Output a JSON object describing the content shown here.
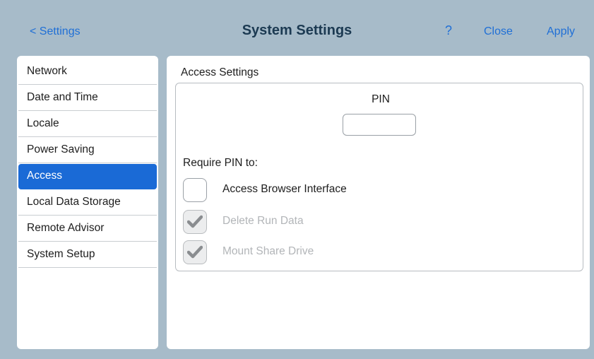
{
  "header": {
    "back_label": "< Settings",
    "title": "System Settings",
    "help_label": "?",
    "close_label": "Close",
    "apply_label": "Apply"
  },
  "sidebar": {
    "items": [
      {
        "label": "Network",
        "active": false
      },
      {
        "label": "Date and Time",
        "active": false
      },
      {
        "label": "Locale",
        "active": false
      },
      {
        "label": "Power Saving",
        "active": false
      },
      {
        "label": "Access",
        "active": true
      },
      {
        "label": "Local Data Storage",
        "active": false
      },
      {
        "label": "Remote Advisor",
        "active": false
      },
      {
        "label": "System Setup",
        "active": false
      }
    ]
  },
  "main": {
    "section_title": "Access Settings",
    "pin_label": "PIN",
    "pin_value": "",
    "require_label": "Require PIN to:",
    "options": [
      {
        "label": "Access Browser Interface",
        "checked": false,
        "disabled": false
      },
      {
        "label": "Delete Run Data",
        "checked": true,
        "disabled": true
      },
      {
        "label": "Mount Share Drive",
        "checked": true,
        "disabled": true
      }
    ]
  },
  "colors": {
    "background": "#a7bbc9",
    "accent": "#1a6ad6",
    "link": "#1f6fd6",
    "title": "#1c3a52"
  },
  "icons": {
    "checkmark": "check-icon"
  }
}
